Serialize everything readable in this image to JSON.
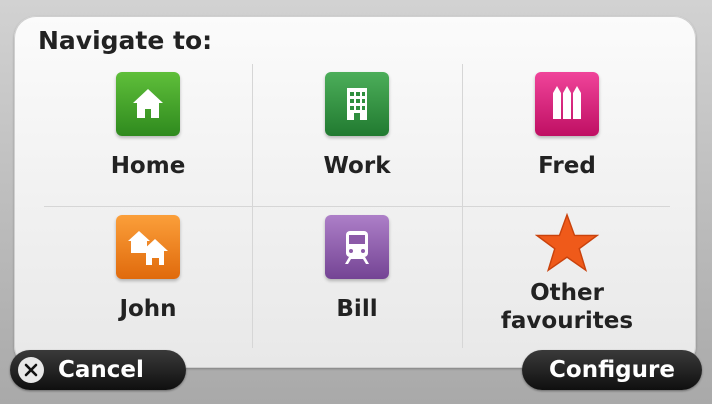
{
  "header": {
    "title": "Navigate to:"
  },
  "favourites": [
    {
      "label": "Home",
      "icon": "home-icon",
      "color": "#3e9b27"
    },
    {
      "label": "Work",
      "icon": "building-icon",
      "color": "#2f8e3e"
    },
    {
      "label": "Fred",
      "icon": "pencils-icon",
      "color": "#d81a7a"
    },
    {
      "label": "John",
      "icon": "houses-icon",
      "color": "#f07d16"
    },
    {
      "label": "Bill",
      "icon": "train-icon",
      "color": "#8c5aa8"
    },
    {
      "label": "Other favourites",
      "icon": "star-icon",
      "color": "#ef5a1a"
    }
  ],
  "buttons": {
    "cancel": "Cancel",
    "configure": "Configure"
  }
}
